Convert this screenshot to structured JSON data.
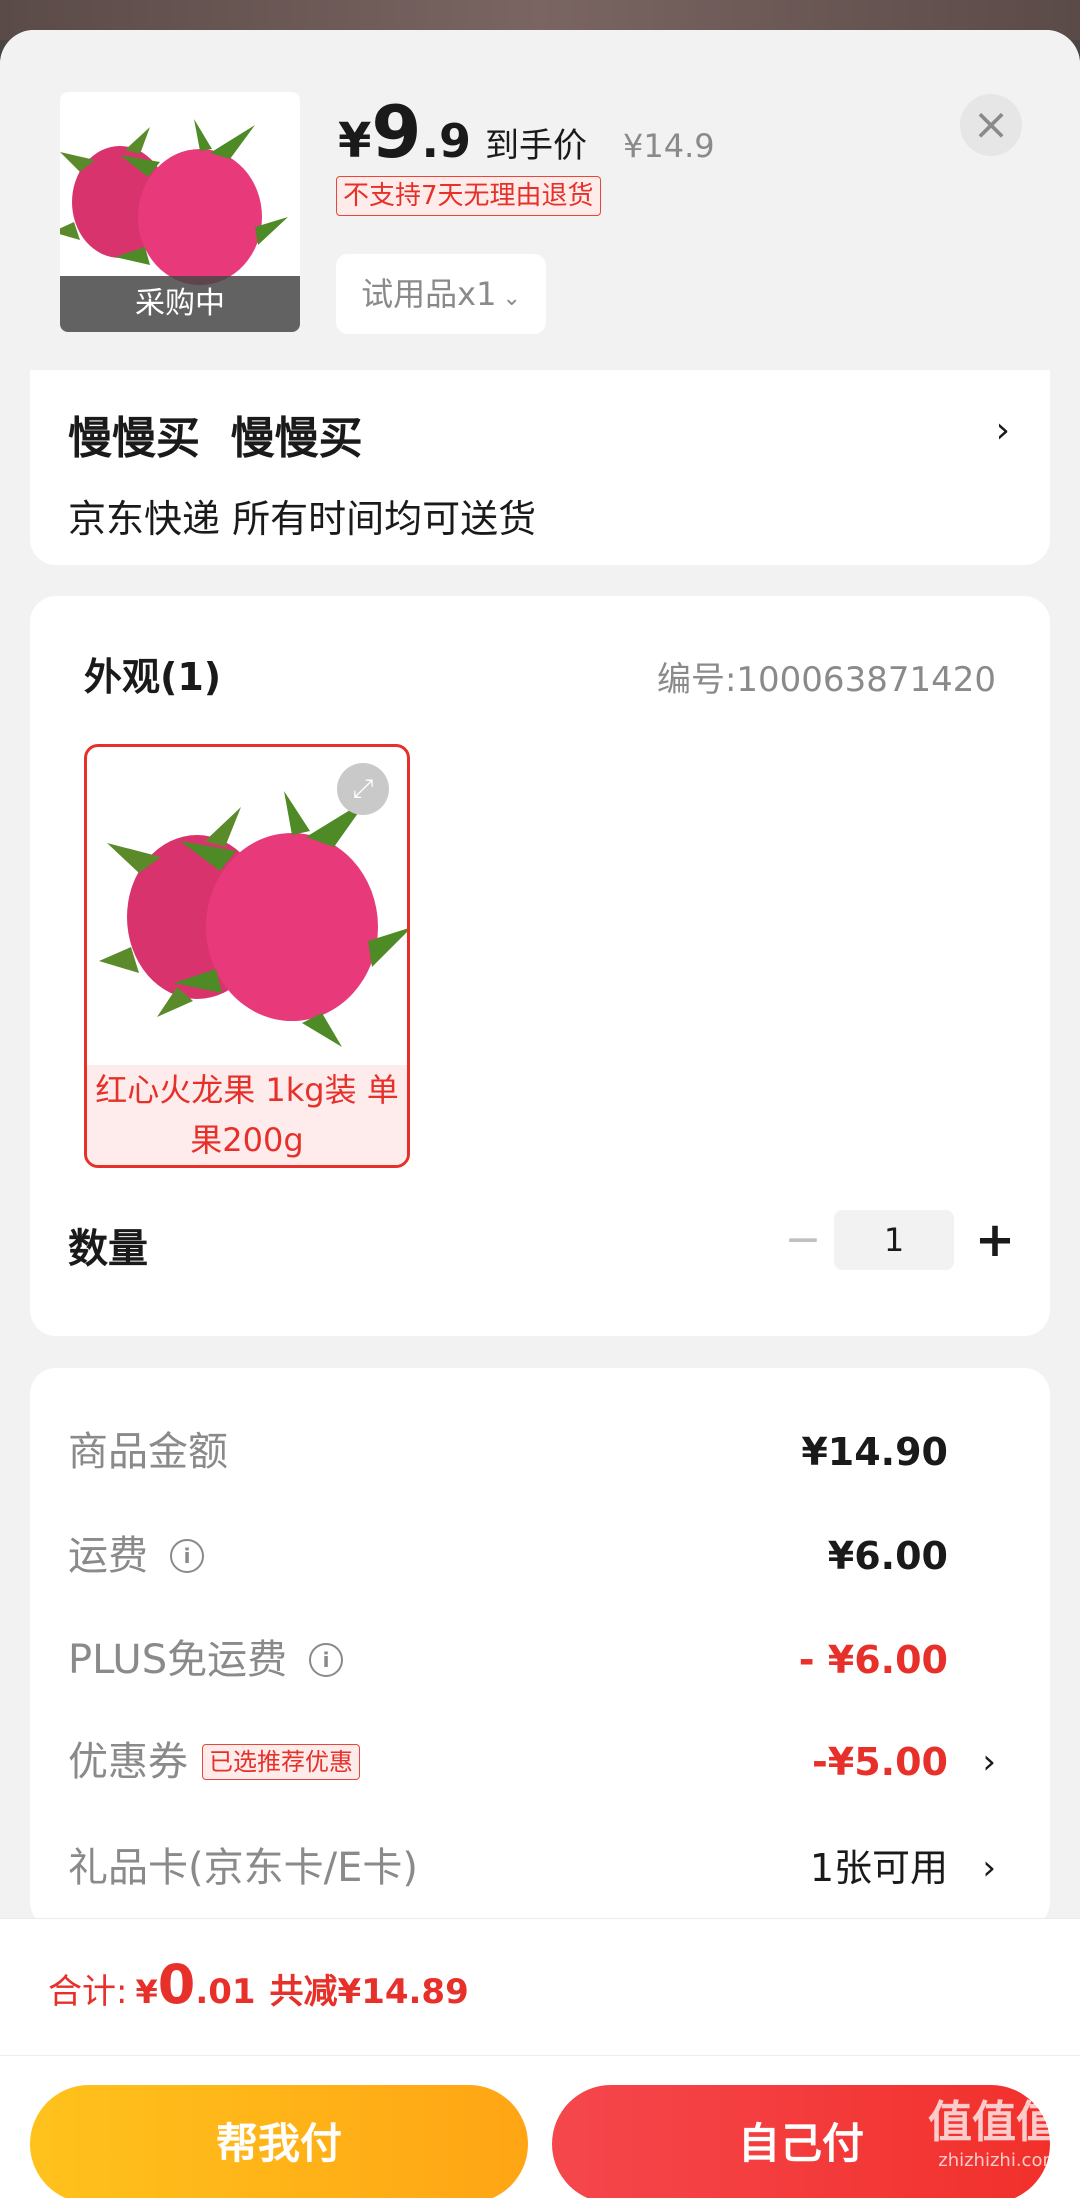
{
  "product": {
    "thumb_badge": "采购中",
    "currency": "¥",
    "price_int": "9",
    "price_dec": ".9",
    "price_label": "到手价",
    "original_price": "¥14.9",
    "return_tag": "不支持7天无理由退货",
    "spec_selected": "试用品x1",
    "close_icon": "close-icon"
  },
  "delivery": {
    "title": "慢慢买  慢慢买",
    "subtitle": "京东快递 所有时间均可送货"
  },
  "spec": {
    "title": "外观(1)",
    "sku_no": "编号:100063871420",
    "option_label": "红心火龙果 1kg装 单果200g",
    "quantity_label": "数量",
    "quantity": "1",
    "minus": "−",
    "plus": "+"
  },
  "fees": [
    {
      "name": "商品金额",
      "value": "¥14.90"
    },
    {
      "name": "运费",
      "value": "¥6.00"
    },
    {
      "name": "PLUS免运费",
      "value": "- ¥6.00"
    },
    {
      "name": "优惠券",
      "tag": "已选推荐优惠",
      "value": "-¥5.00"
    },
    {
      "name": "礼品卡(京东卡/E卡)",
      "value": "1张可用"
    }
  ],
  "footer": {
    "total_label": "合计:",
    "total_currency": "¥",
    "total_int": "0",
    "total_dec": ".01",
    "total_saved": "共减¥14.89",
    "help_pay": "帮我付",
    "self_pay": "自己付"
  },
  "watermark": {
    "text": "值值值",
    "sub": "zhizhizhi.com"
  },
  "colors": {
    "accent_red": "#e8302a",
    "gold": "#ffb519",
    "background": "#f2f2f2"
  }
}
